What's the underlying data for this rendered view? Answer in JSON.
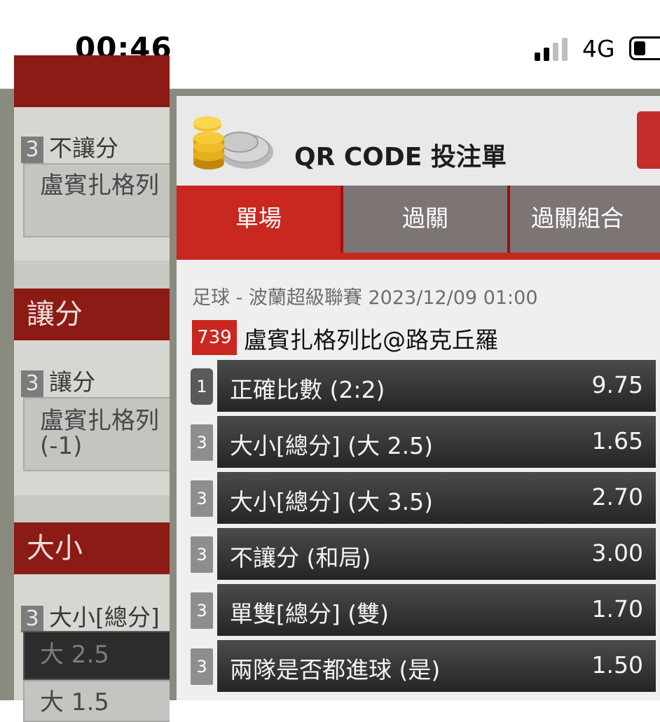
{
  "status_bar": {
    "time": "00:46",
    "network": "4G"
  },
  "background": {
    "sections": [
      {
        "header": "",
        "market_num": "3",
        "market_label": "不讓分",
        "option": "盧賓扎格列"
      },
      {
        "header": "讓分",
        "market_num": "3",
        "market_label": "讓分",
        "option_line1": "盧賓扎格列",
        "option_line2": "(-1)"
      },
      {
        "header": "大小",
        "market_num": "3",
        "market_label": "大小[總分]",
        "option1": "大 2.5",
        "option2": "大 1.5"
      }
    ]
  },
  "modal": {
    "title": "QR CODE 投注單",
    "tabs": [
      {
        "label": "單場"
      },
      {
        "label": "過關"
      },
      {
        "label": "過關組合"
      }
    ],
    "match_meta": "足球 - 波蘭超級聯賽 2023/12/09 01:00",
    "match_no": "739",
    "match_name": "盧賓扎格列比@路克丘羅",
    "bets": [
      {
        "idx": "1",
        "label": "正確比數 (2:2)",
        "odds": "9.75"
      },
      {
        "idx": "3",
        "label": "大小[總分] (大 2.5)",
        "odds": "1.65"
      },
      {
        "idx": "3",
        "label": "大小[總分] (大 3.5)",
        "odds": "2.70"
      },
      {
        "idx": "3",
        "label": "不讓分 (和局)",
        "odds": "3.00"
      },
      {
        "idx": "3",
        "label": "單雙[總分] (雙)",
        "odds": "1.70"
      },
      {
        "idx": "3",
        "label": "兩隊是否都進球 (是)",
        "odds": "1.50"
      }
    ]
  }
}
